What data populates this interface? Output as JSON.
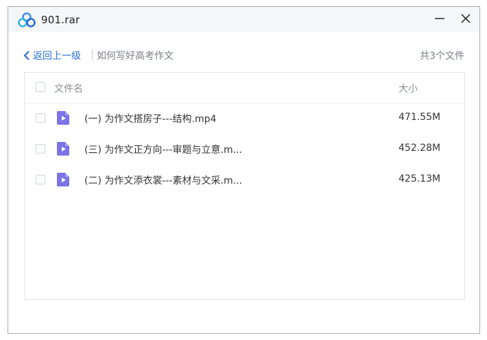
{
  "window": {
    "title": "901.rar"
  },
  "nav": {
    "back_label": "返回上一级",
    "folder_name": "如何写好高考作文",
    "file_count": "共3个文件"
  },
  "table": {
    "columns": {
      "name": "文件名",
      "size": "大小"
    },
    "rows": [
      {
        "name": "(一) 为作文搭房子---结构.mp4",
        "size": "471.55M",
        "icon": "video-file-icon"
      },
      {
        "name": "(三) 为作文正方向---审题与立意.m...",
        "size": "452.28M",
        "icon": "video-file-icon"
      },
      {
        "name": "(二) 为作文添衣裳---素材与文采.m...",
        "size": "425.13M",
        "icon": "video-file-icon"
      }
    ]
  },
  "colors": {
    "accent": "#2a6fd6",
    "file_icon": "#7b73e6"
  }
}
